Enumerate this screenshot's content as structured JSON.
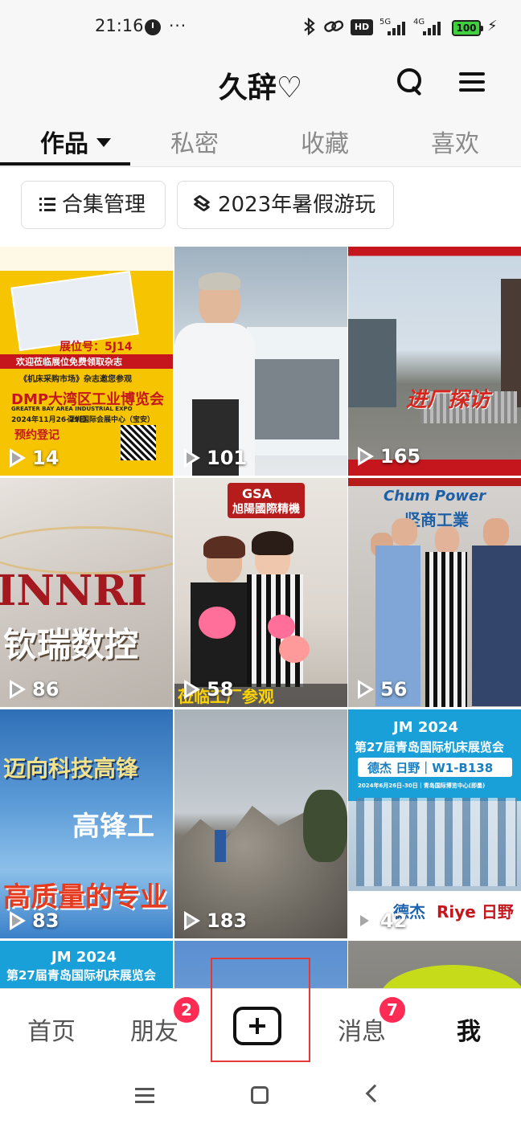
{
  "status_bar": {
    "time": "21:16",
    "more": "···",
    "hd": "HD",
    "net1": "5G",
    "net2": "4G",
    "battery": "100"
  },
  "header": {
    "title": "久辞♡"
  },
  "tabs": [
    {
      "label": "作品"
    },
    {
      "label": "私密"
    },
    {
      "label": "收藏"
    },
    {
      "label": "喜欢"
    }
  ],
  "chips": [
    {
      "label": "合集管理"
    },
    {
      "label": "2023年暑假游玩"
    }
  ],
  "videos": [
    {
      "views": "14",
      "texts": [
        "展位号：5J14",
        "欢迎莅临展位免费领取杂志",
        "《机床采购市场》杂志邀您参观",
        "DMP大湾区工业博览会",
        "GREATER BAY AREA INDUSTRIAL EXPO",
        "2024年11月26-29日",
        "深圳国际会展中心（宝安）",
        "预约登记"
      ]
    },
    {
      "views": "101",
      "texts": []
    },
    {
      "views": "165",
      "texts": [
        "进厂探访"
      ]
    },
    {
      "views": "86",
      "texts": [
        "INNRI",
        "钦瑞数控"
      ]
    },
    {
      "views": "58",
      "texts": [
        "GSA",
        "旭陽國際精機",
        "莅临工厂参观"
      ]
    },
    {
      "views": "56",
      "texts": [
        "Chum Power",
        "坚商工業"
      ]
    },
    {
      "views": "83",
      "texts": [
        "迈向科技高锋",
        "高锋工",
        "高质量的专业"
      ]
    },
    {
      "views": "183",
      "texts": []
    },
    {
      "views": "42",
      "texts": [
        "JM 2024",
        "第27届青岛国际机床展览会",
        "德杰 日野｜W1-B138",
        "2024年6月26日-30日｜青岛国际博览中心(即墨)",
        "德杰",
        "Riye 日野"
      ]
    },
    {
      "views": "",
      "texts": [
        "JM 2024",
        "第27届青岛国际机床展览会"
      ]
    },
    {
      "views": "",
      "texts": []
    },
    {
      "views": "",
      "texts": []
    }
  ],
  "bottom_nav": {
    "home": "首页",
    "friends": "朋友",
    "friends_badge": "2",
    "messages": "消息",
    "messages_badge": "7",
    "me": "我"
  }
}
